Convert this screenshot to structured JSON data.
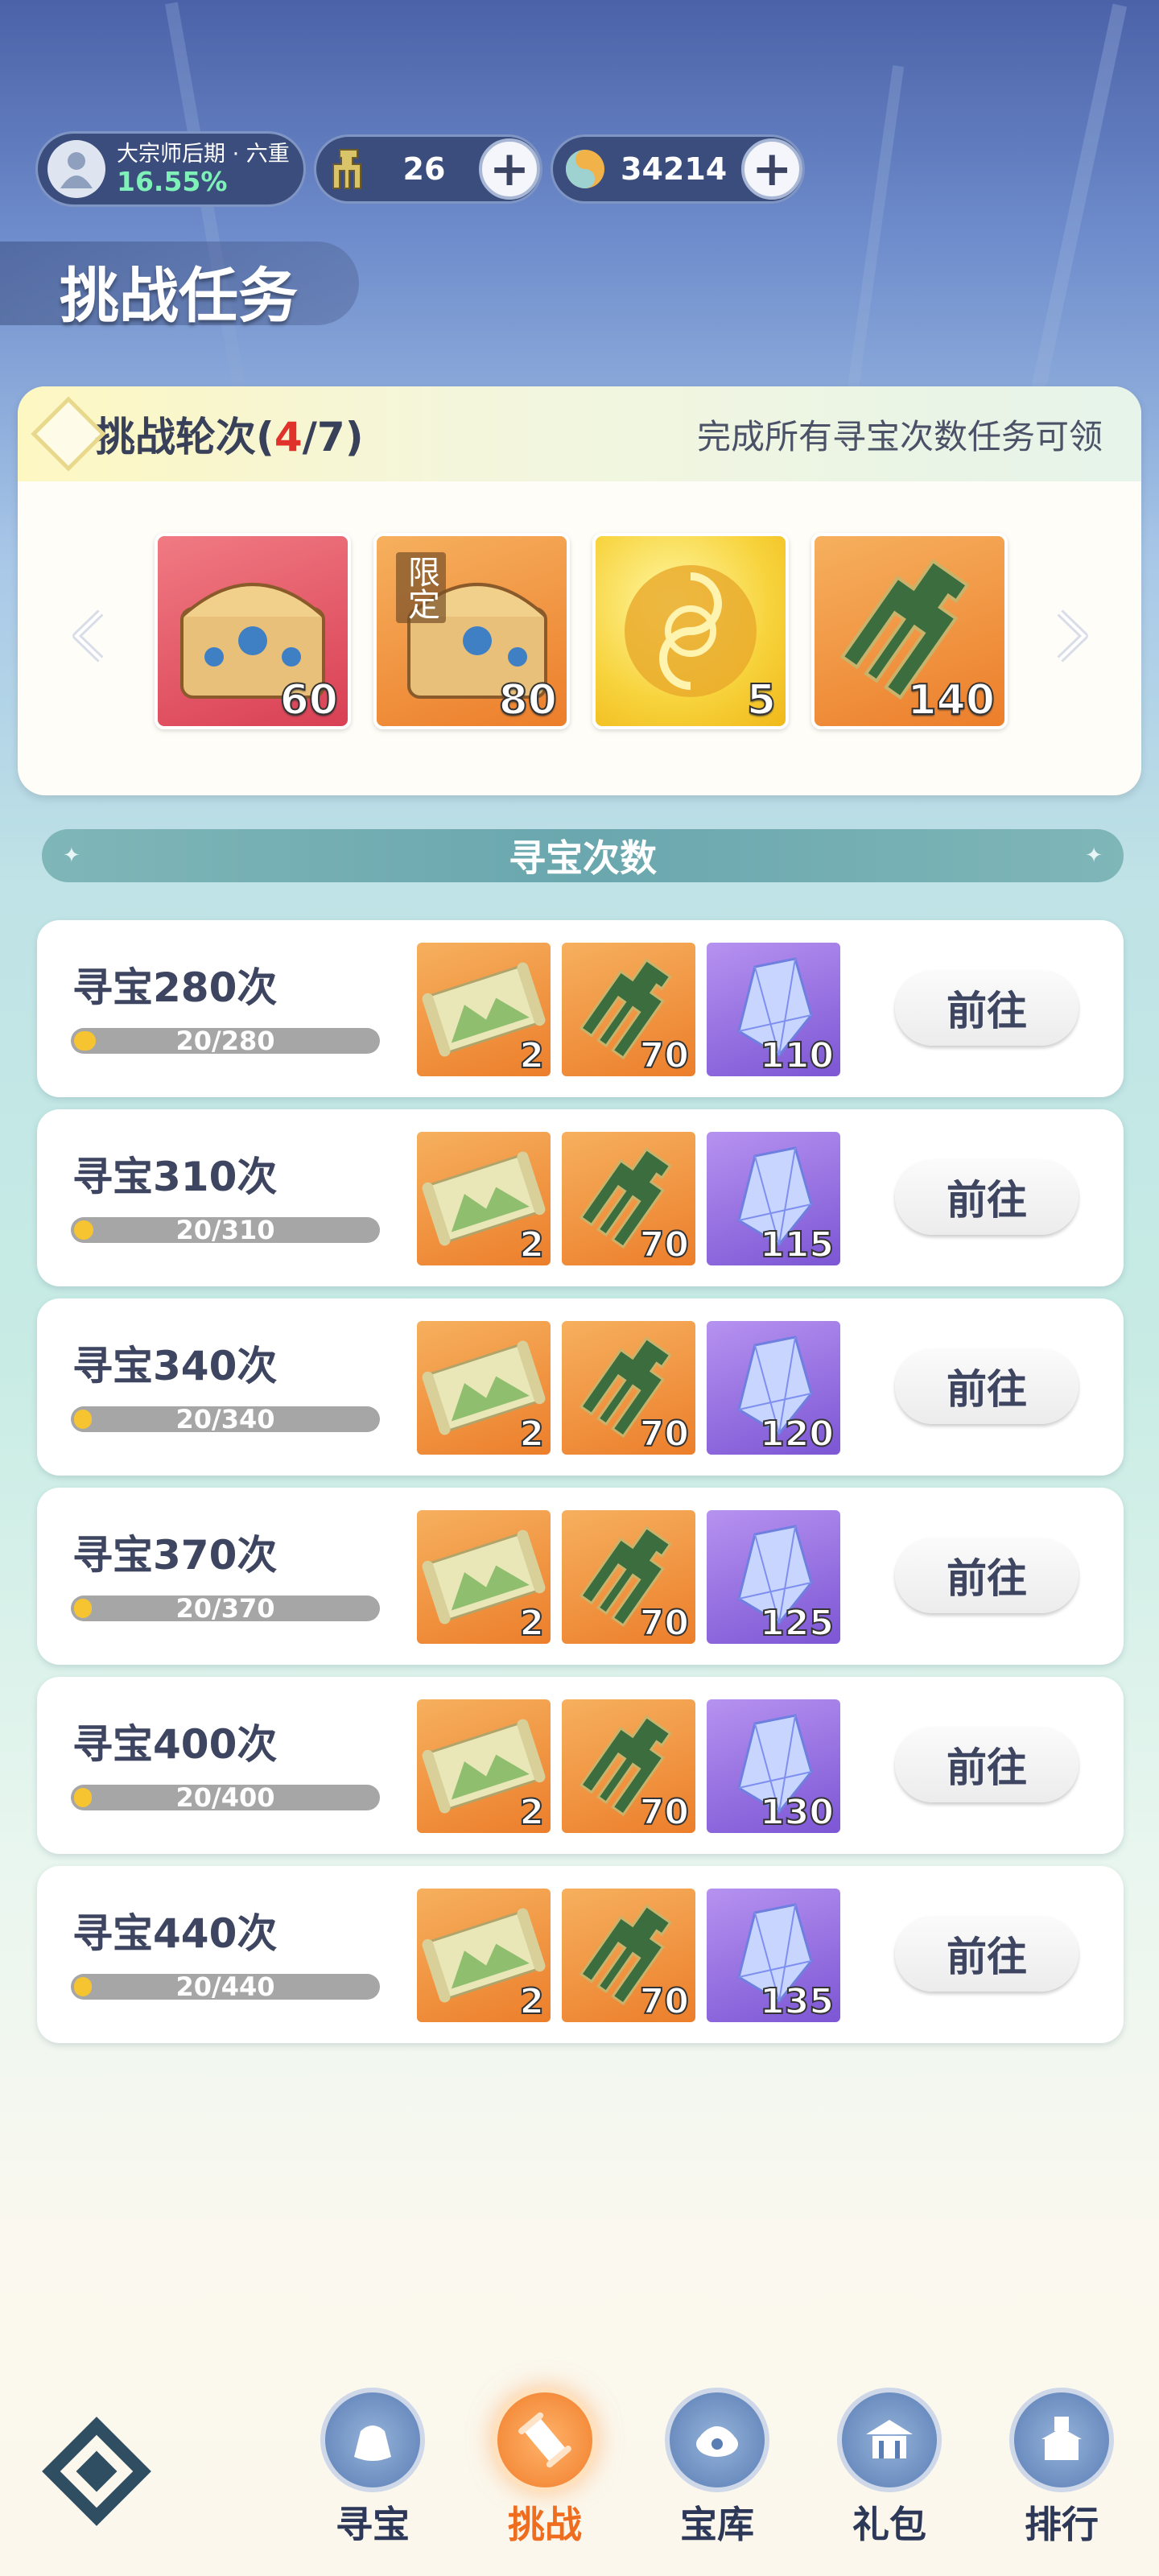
{
  "header": {
    "rank": "大宗师后期 · 六重",
    "progress": "16.55%",
    "token_count": "26",
    "coin_count": "34214",
    "plus_symbol": "+"
  },
  "page_title": "挑战任务",
  "round": {
    "label": "挑战轮次(",
    "current": "4",
    "sep_total": "/7)",
    "note": "完成所有寻宝次数任务可领",
    "rewards": [
      {
        "icon": "treasure-chest-icon",
        "count": "60",
        "bg": "red"
      },
      {
        "icon": "limited-chest-icon",
        "count": "80",
        "bg": "orange",
        "tag": "限定"
      },
      {
        "icon": "gold-orb-icon",
        "count": "5",
        "bg": "yellow"
      },
      {
        "icon": "jade-token-icon",
        "count": "140",
        "bg": "orange"
      }
    ]
  },
  "section_title": "寻宝次数",
  "tasks": [
    {
      "name": "寻宝280次",
      "progress": "20/280",
      "ratio": 0.0714,
      "scroll": "2",
      "token": "70",
      "crystal": "110",
      "button": "前往"
    },
    {
      "name": "寻宝310次",
      "progress": "20/310",
      "ratio": 0.0645,
      "scroll": "2",
      "token": "70",
      "crystal": "115",
      "button": "前往"
    },
    {
      "name": "寻宝340次",
      "progress": "20/340",
      "ratio": 0.0588,
      "scroll": "2",
      "token": "70",
      "crystal": "120",
      "button": "前往"
    },
    {
      "name": "寻宝370次",
      "progress": "20/370",
      "ratio": 0.0541,
      "scroll": "2",
      "token": "70",
      "crystal": "125",
      "button": "前往"
    },
    {
      "name": "寻宝400次",
      "progress": "20/400",
      "ratio": 0.05,
      "scroll": "2",
      "token": "70",
      "crystal": "130",
      "button": "前往"
    },
    {
      "name": "寻宝440次",
      "progress": "20/440",
      "ratio": 0.0455,
      "scroll": "2",
      "token": "70",
      "crystal": "135",
      "button": "前往"
    }
  ],
  "nav": [
    {
      "label": "寻宝",
      "icon": "treasure-bag-icon",
      "active": false
    },
    {
      "label": "挑战",
      "icon": "scroll-icon",
      "active": true
    },
    {
      "label": "宝库",
      "icon": "vault-icon",
      "active": false
    },
    {
      "label": "礼包",
      "icon": "gift-pavilion-icon",
      "active": false
    },
    {
      "label": "排行",
      "icon": "ranking-tower-icon",
      "active": false
    }
  ],
  "colors": {
    "accent": "#ef6d1e",
    "highlight_red": "#e0322a",
    "progress_fill": "#f7c431"
  }
}
